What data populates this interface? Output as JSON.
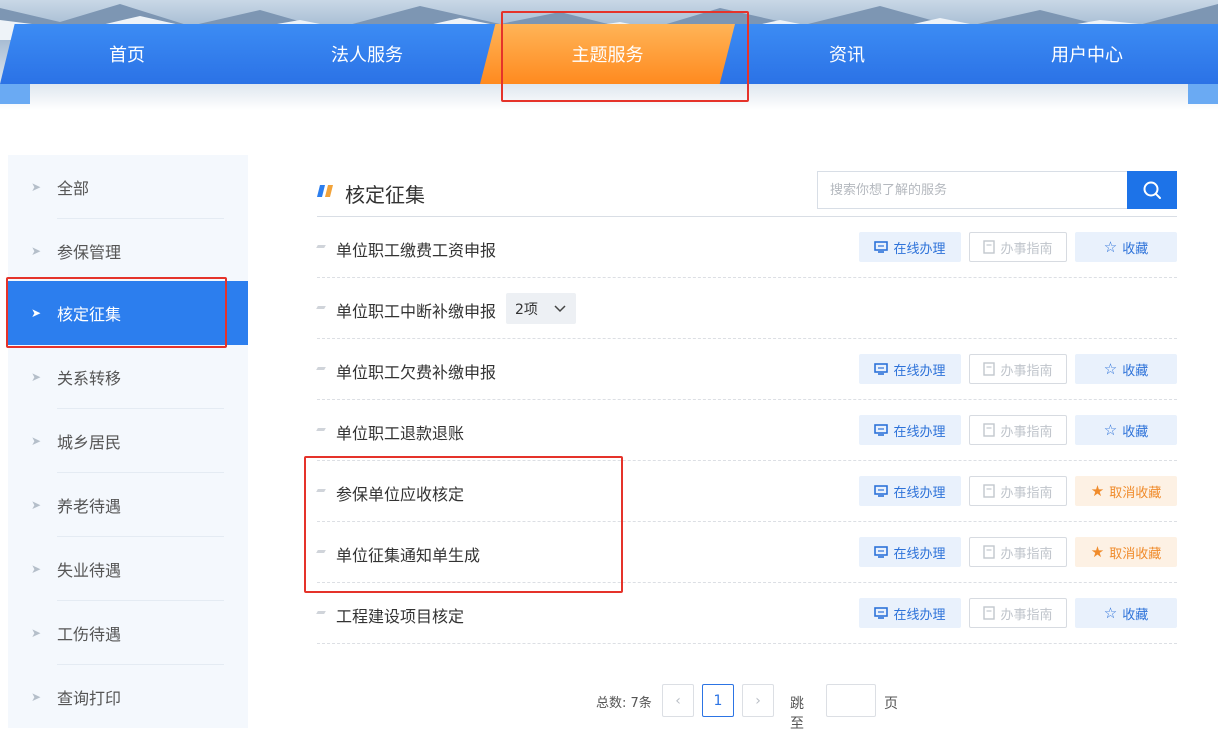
{
  "nav": {
    "items": [
      {
        "label": "首页"
      },
      {
        "label": "法人服务"
      },
      {
        "label": "主题服务"
      },
      {
        "label": "资讯"
      },
      {
        "label": "用户中心"
      }
    ],
    "active_index": 2
  },
  "sidebar": {
    "items": [
      {
        "label": "全部"
      },
      {
        "label": "参保管理"
      },
      {
        "label": "核定征集"
      },
      {
        "label": "关系转移"
      },
      {
        "label": "城乡居民"
      },
      {
        "label": "养老待遇"
      },
      {
        "label": "失业待遇"
      },
      {
        "label": "工伤待遇"
      },
      {
        "label": "查询打印"
      }
    ],
    "active_index": 2
  },
  "main": {
    "title": "核定征集",
    "search": {
      "placeholder": "搜索你想了解的服务",
      "value": ""
    },
    "buttons": {
      "online": "在线办理",
      "guide": "办事指南",
      "favorite": "收藏",
      "unfavorite": "取消收藏"
    },
    "services": [
      {
        "name": "单位职工缴费工资申报",
        "favorited": false
      },
      {
        "name": "单位职工中断补缴申报",
        "group_count": "2项"
      },
      {
        "name": "单位职工欠费补缴申报",
        "favorited": false
      },
      {
        "name": "单位职工退款退账",
        "favorited": false
      },
      {
        "name": "参保单位应收核定",
        "favorited": true
      },
      {
        "name": "单位征集通知单生成",
        "favorited": true
      },
      {
        "name": "工程建设项目核定",
        "favorited": false
      }
    ]
  },
  "pagination": {
    "total": "总数: 7条",
    "current_page": "1",
    "jump_label": "跳至",
    "page_unit": "页",
    "jump_value": ""
  },
  "colors": {
    "primary": "#2c7eee",
    "nav_active": "#ff8a1f",
    "highlight_box": "#e5332a",
    "favorite_active": "#f08b2b"
  }
}
